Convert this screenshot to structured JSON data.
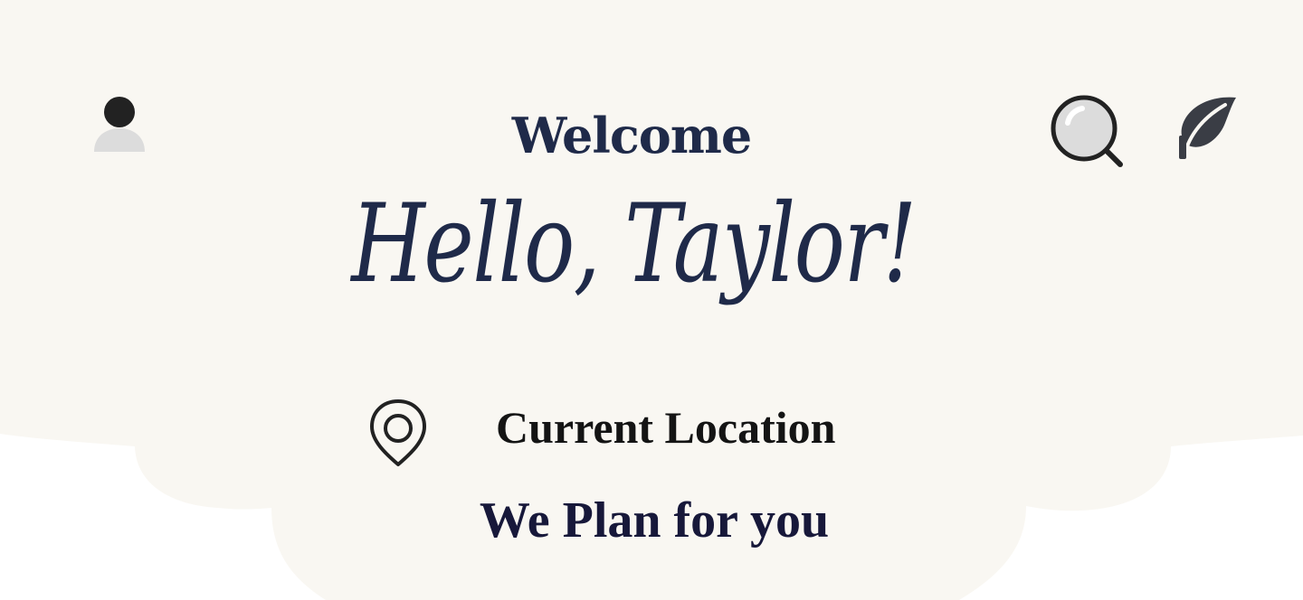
{
  "header": {
    "welcome": "Welcome",
    "greeting": "Hello, Taylor!"
  },
  "icons": {
    "profile": "user-icon",
    "search": "search-icon",
    "leaf": "leaf-icon",
    "location": "location-pin-icon"
  },
  "location": {
    "label": "Current Location"
  },
  "tagline": "We Plan for you",
  "colors": {
    "background_blob": "#f9f7f2",
    "page": "#ffffff",
    "heading": "#1f2a49",
    "tagline": "#17183a",
    "icon_dark": "#222222",
    "icon_light": "#dcdcdc"
  }
}
